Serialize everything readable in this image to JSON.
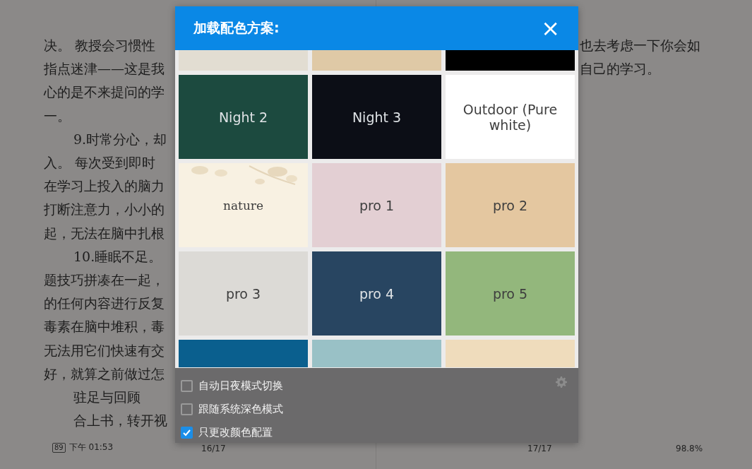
{
  "reader": {
    "left_lines": [
      {
        "text": "决。 教授会习惯性",
        "indent": false
      },
      {
        "text": "指点迷津——这是我",
        "indent": false
      },
      {
        "text": "心的是不来提问的学",
        "indent": false
      },
      {
        "text": "一。",
        "indent": false
      },
      {
        "text": "9.时常分心，却",
        "indent": true
      },
      {
        "text": "入。 每次受到即时",
        "indent": false
      },
      {
        "text": "在学习上投入的脑力",
        "indent": false
      },
      {
        "text": "打断注意力，小小的",
        "indent": false
      },
      {
        "text": "起，无法在脑中扎根",
        "indent": false
      },
      {
        "text": "10.睡眠不足。",
        "indent": true
      },
      {
        "text": "题技巧拼凑在一起，",
        "indent": false
      },
      {
        "text": "的任何内容进行反复",
        "indent": false
      },
      {
        "text": "毒素在脑中堆积，毒",
        "indent": false
      },
      {
        "text": "无法用它们快速有交",
        "indent": false
      },
      {
        "text": "好，就算之前做过怎",
        "indent": false
      },
      {
        "text": "驻足与回顾",
        "indent": true
      },
      {
        "text": "合上书，转开视",
        "indent": true
      }
    ],
    "right_lines": [
      "也去考虑一下你会如",
      "自己的学习。"
    ],
    "footer": {
      "battery": "89",
      "time": "下午 01:53",
      "left_page": "16/17",
      "right_page": "17/17",
      "progress": "98.8%"
    }
  },
  "dialog": {
    "title": "加载配色方案:",
    "close": "×",
    "rows": [
      {
        "tiles": [
          {
            "kind": "plain",
            "color": "#e2ddd2"
          },
          {
            "kind": "plain",
            "color": "#dfc9a6"
          },
          {
            "kind": "plain",
            "color": "#000000"
          }
        ]
      },
      {
        "tiles": [
          {
            "kind": "plain",
            "color": "#1c4a3f",
            "label": "Night 2"
          },
          {
            "kind": "plain",
            "color": "#0c0e16",
            "label": "Night 3"
          },
          {
            "kind": "plain",
            "color": "#ffffff",
            "label": "Outdoor (Pure white)"
          }
        ]
      },
      {
        "tiles": [
          {
            "kind": "floral",
            "color": "#f8f1e2",
            "label": "nature"
          },
          {
            "kind": "plain",
            "color": "#e3cfd3",
            "label": "pro 1"
          },
          {
            "kind": "plain",
            "color": "#e4c7a0",
            "label": "pro 2"
          }
        ]
      },
      {
        "tiles": [
          {
            "kind": "plain",
            "color": "#dcdad6",
            "label": "pro 3"
          },
          {
            "kind": "plain",
            "color": "#284561",
            "label": "pro 4"
          },
          {
            "kind": "plain",
            "color": "#93b77c",
            "label": "pro 5"
          }
        ]
      },
      {
        "tiles": [
          {
            "kind": "plain",
            "color": "#0a5f8e"
          },
          {
            "kind": "plain",
            "color": "#99c1c6"
          },
          {
            "kind": "plain",
            "color": "#efdcbc"
          }
        ]
      }
    ],
    "options": [
      {
        "label": "自动日夜模式切换",
        "checked": false
      },
      {
        "label": "跟随系统深色模式",
        "checked": false
      },
      {
        "label": "只更改颜色配置",
        "checked": true
      }
    ]
  }
}
